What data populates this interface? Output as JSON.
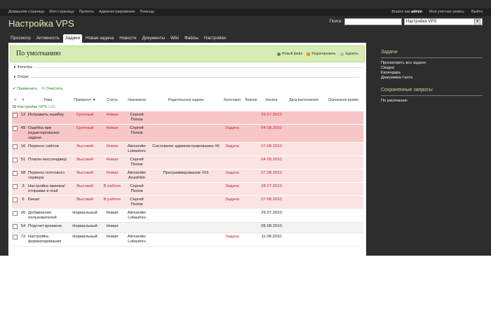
{
  "topbar": {
    "left_links": [
      "Домашняя страница",
      "Моя страница",
      "Проекты",
      "Администрирование",
      "Помощь"
    ],
    "logged_in_label": "Вошел как",
    "username": "admin",
    "account_link": "Моя учетная запись",
    "logout_link": "Выйти"
  },
  "header": {
    "project_title": "Настройка VPS",
    "search_label": "Поиск:",
    "search_value": "",
    "project_select": "Настройка VPS"
  },
  "tabs": [
    "Просмотр",
    "Активность",
    "Задачи",
    "Новая задача",
    "Новости",
    "Документы",
    "Wiki",
    "Файлы",
    "Настройки"
  ],
  "active_tab": "Задачи",
  "main": {
    "query_title": "По умолчанию",
    "actions": {
      "new_file": "Новый файл",
      "edit": "Редактировать",
      "delete": "Удалить"
    },
    "filters_label": "Фильтры",
    "options_label": "Опции",
    "apply_label": "Применить",
    "clear_label": "Очистить",
    "columns": [
      "#",
      "Тема",
      "Приоритет",
      "Статус",
      "Назначена",
      "Родительская задача",
      "Категория",
      "Версия",
      "Начата",
      "Дата выполнения",
      "Оцененное время"
    ],
    "group": {
      "name": "Настройка VPS",
      "count": "(19)"
    },
    "rows": [
      {
        "id": "12",
        "subject": "Исправить ошибку",
        "priority": "Срочный",
        "status": "Новая",
        "assignee": "Сергей Попов",
        "parent": "",
        "category": "",
        "version": "",
        "start": "29.07.2010",
        "style": "pink"
      },
      {
        "id": "49",
        "subject": "Ошибка при редактировании задачи",
        "priority": "Срочный",
        "status": "Новая",
        "assignee": "Сергей Попов",
        "parent": "",
        "category": "Задача",
        "version": "",
        "start": "04.08.2010",
        "style": "pink"
      },
      {
        "id": "16",
        "subject": "Перенос сайтов",
        "priority": "Высокий",
        "status": "Новая",
        "assignee": "Alexander Lobashev",
        "parent": "Системное администрирование #6",
        "category": "Задача",
        "version": "",
        "start": "07.08.2010",
        "style": "lpink"
      },
      {
        "id": "51",
        "subject": "Плагин мессенджер",
        "priority": "Высокий",
        "status": "Новая",
        "assignee": "Сергей Попов",
        "parent": "",
        "category": "",
        "version": "",
        "start": "04.08.2010",
        "style": "lpink"
      },
      {
        "id": "58",
        "subject": "Перенос почтового сервера",
        "priority": "Высокий",
        "status": "Новая",
        "assignee": "Alexander Anashkin",
        "parent": "Программирование #16",
        "category": "Задача",
        "version": "",
        "start": "07.08.2010",
        "style": "lpink"
      },
      {
        "id": "3",
        "subject": "Настройка приема/отправки e-mail",
        "priority": "Высокий",
        "status": "В работе",
        "assignee": "Сергей Попов",
        "parent": "",
        "category": "Задача",
        "version": "",
        "start": "28.07.2010",
        "style": "lpink"
      },
      {
        "id": "6",
        "subject": "Бекап",
        "priority": "Высокий",
        "status": "В работе",
        "assignee": "Сергей Попов",
        "parent": "",
        "category": "Задача",
        "version": "",
        "start": "07.08.2010",
        "style": "lpink"
      },
      {
        "id": "26",
        "subject": "Добавление пользователей",
        "priority": "Нормальный",
        "status": "Новая",
        "assignee": "Alexander Lobashev",
        "parent": "",
        "category": "",
        "version": "",
        "start": "29.07.2010",
        "style": "white"
      },
      {
        "id": "54",
        "subject": "Подсчет времени",
        "priority": "Нормальный",
        "status": "Новая",
        "assignee": "",
        "parent": "",
        "category": "",
        "version": "",
        "start": "05.08.2010",
        "style": "grey"
      },
      {
        "id": "72",
        "subject": "Настройка форматирования",
        "priority": "Нормальный",
        "status": "Новая",
        "assignee": "Alexander Lobashev",
        "parent": "",
        "category": "Задача",
        "version": "",
        "start": "11.08.2010",
        "style": "white"
      }
    ]
  },
  "sidebar": {
    "tasks_header": "Задачи",
    "tasks_links": [
      "Просмотреть все задачи",
      "Сводка",
      "Календарь",
      "Диаграмма Ганта"
    ],
    "saved_header": "Сохраненные запросы",
    "saved_links": [
      "По умолчанию"
    ]
  },
  "colors": {
    "page_bg": "#2d2d2d",
    "title_green": "#e6f0b4",
    "high_row": "#f8c6c7",
    "normal_row": "#fbe3e3",
    "urgent_text": "#c0262c"
  }
}
